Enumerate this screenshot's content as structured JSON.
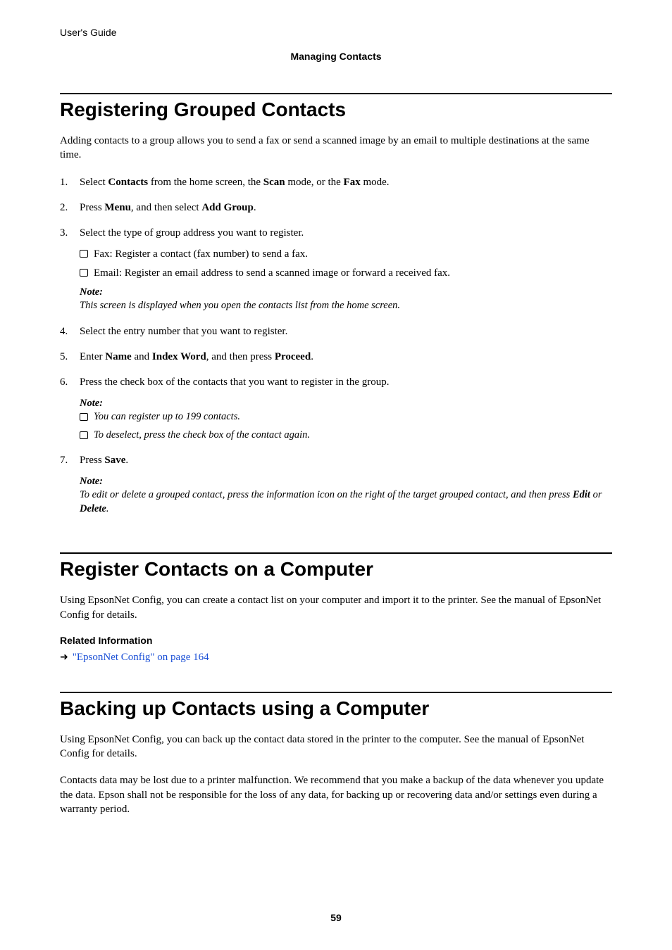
{
  "header": {
    "guide": "User's Guide",
    "section": "Managing Contacts"
  },
  "section1": {
    "title": "Registering Grouped Contacts",
    "intro": "Adding contacts to a group allows you to send a fax or send a scanned image by an email to multiple destinations at the same time.",
    "step1_a": "Select ",
    "step1_b": "Contacts",
    "step1_c": " from the home screen, the ",
    "step1_d": "Scan",
    "step1_e": " mode, or the ",
    "step1_f": "Fax",
    "step1_g": " mode.",
    "step2_a": "Press ",
    "step2_b": "Menu",
    "step2_c": ", and then select ",
    "step2_d": "Add Group",
    "step2_e": ".",
    "step3": "Select the type of group address you want to register.",
    "step3_sub1": "Fax: Register a contact (fax number) to send a fax.",
    "step3_sub2": "Email: Register an email address to send a scanned image or forward a received fax.",
    "step3_note_label": "Note:",
    "step3_note": "This screen is displayed when you open the contacts list from the home screen.",
    "step4": "Select the entry number that you want to register.",
    "step5_a": "Enter ",
    "step5_b": "Name",
    "step5_c": " and ",
    "step5_d": "Index Word",
    "step5_e": ", and then press ",
    "step5_f": "Proceed",
    "step5_g": ".",
    "step6": "Press the check box of the contacts that you want to register in the group.",
    "step6_note_label": "Note:",
    "step6_note_sub1": "You can register up to 199 contacts.",
    "step6_note_sub2": "To deselect, press the check box of the contact again.",
    "step7_a": "Press ",
    "step7_b": "Save",
    "step7_c": ".",
    "step7_note_label": "Note:",
    "step7_note_a": "To edit or delete a grouped contact, press the information icon on the right of the target grouped contact, and then press ",
    "step7_note_b": "Edit",
    "step7_note_c": " or ",
    "step7_note_d": "Delete",
    "step7_note_e": "."
  },
  "section2": {
    "title": "Register Contacts on a Computer",
    "body": "Using EpsonNet Config, you can create a contact list on your computer and import it to the printer. See the manual of EpsonNet Config for details.",
    "related_label": "Related Information",
    "related_link": "\"EpsonNet Config\" on page 164"
  },
  "section3": {
    "title": "Backing up Contacts using a Computer",
    "body1": "Using EpsonNet Config, you can back up the contact data stored in the printer to the computer. See the manual of EpsonNet Config for details.",
    "body2": "Contacts data may be lost due to a printer malfunction. We recommend that you make a backup of the data whenever you update the data. Epson shall not be responsible for the loss of any data, for backing up or recovering data and/or settings even during a warranty period."
  },
  "page_number": "59"
}
